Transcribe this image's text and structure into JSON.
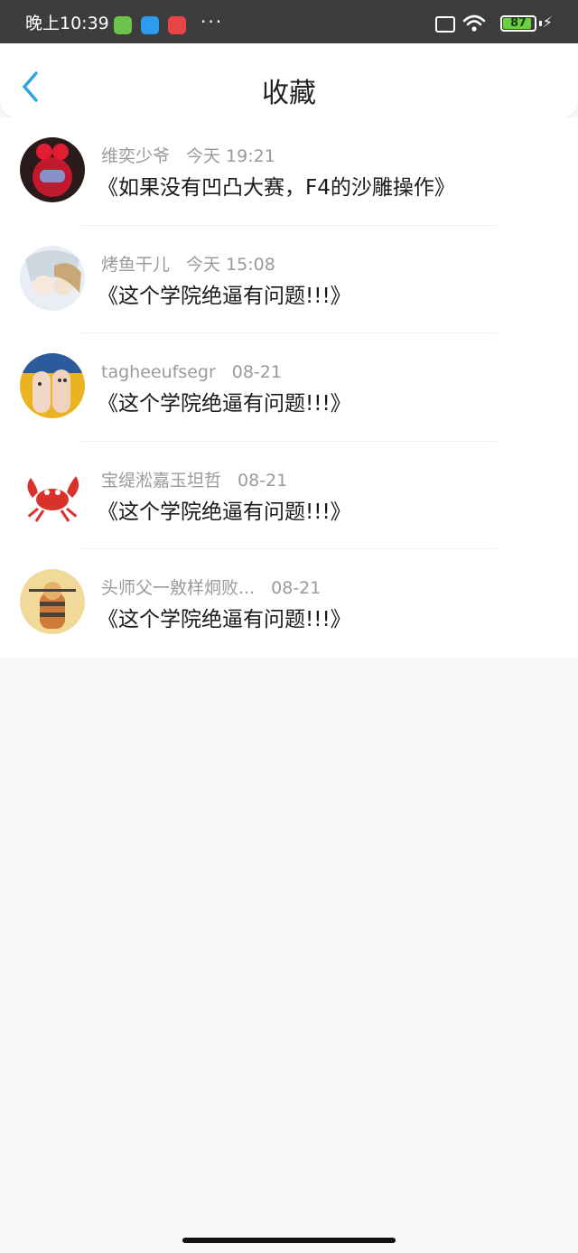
{
  "status_bar": {
    "time": "晚上10:39",
    "battery_level": "87",
    "battery_fraction": 0.87,
    "icons": [
      "download-app-icon",
      "messenger-app-icon",
      "store-app-icon",
      "more-dots",
      "sim-off-icon",
      "wifi-icon",
      "battery-icon",
      "charging-icon"
    ],
    "more": "···"
  },
  "header": {
    "title": "收藏",
    "back_icon": "chevron-left-icon",
    "accent_color": "#2aa3e6"
  },
  "favorites": [
    {
      "name": "维奕少爷",
      "date": "今天 19:21",
      "title": "《如果没有凹凸大赛，F4的沙雕操作》",
      "avatar_colors": [
        "#c0182d",
        "#2b1a1a"
      ]
    },
    {
      "name": "烤鱼干儿",
      "date": "今天 15:08",
      "title": "《这个学院绝逼有问题!!!》",
      "avatar_colors": [
        "#e8eef3",
        "#c9a878"
      ]
    },
    {
      "name": "tagheeufsegr",
      "date": "08-21",
      "title": "《这个学院绝逼有问题!!!》",
      "avatar_colors": [
        "#e9b321",
        "#f1d7c6"
      ]
    },
    {
      "name": "宝缇淞嘉玉坦哲",
      "date": "08-21",
      "title": "《这个学院绝逼有问题!!!》",
      "avatar_colors": [
        "#ffffff",
        "#d9322a"
      ]
    },
    {
      "name": "头师父一敫样炯败...",
      "date": "08-21",
      "title": "《这个学院绝逼有问题!!!》",
      "avatar_colors": [
        "#f1d99a",
        "#4a4236"
      ]
    }
  ]
}
